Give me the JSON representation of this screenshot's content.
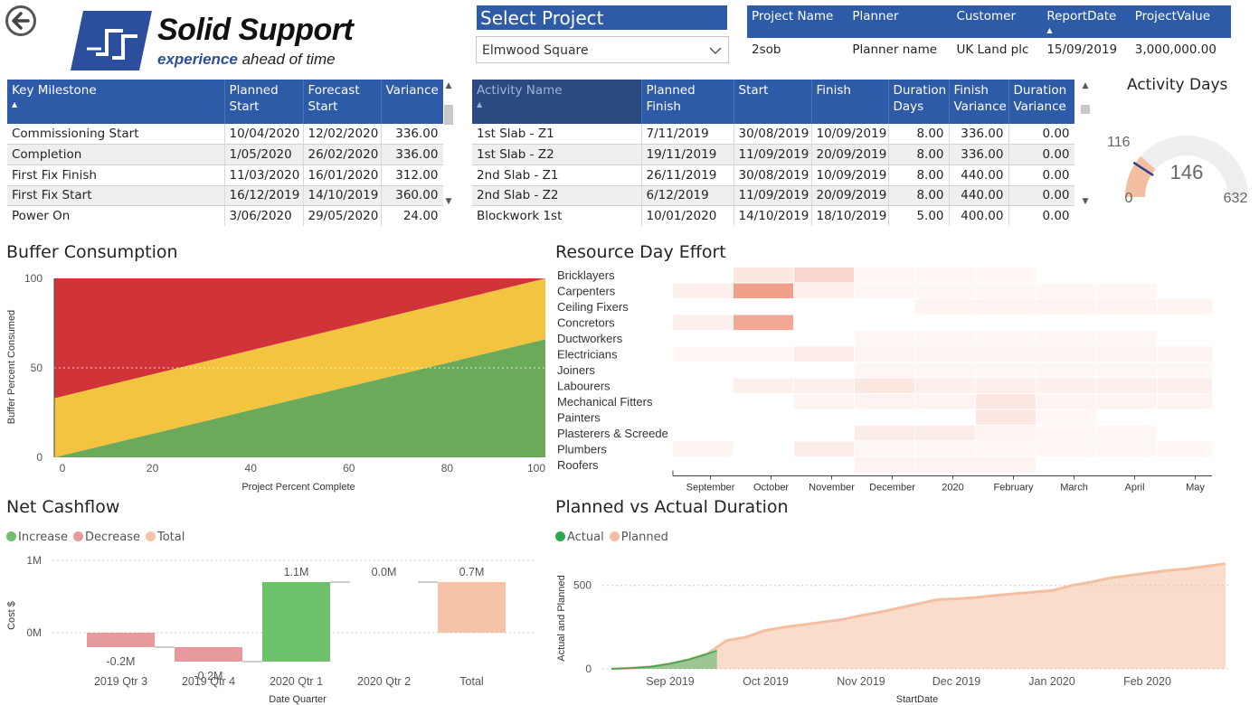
{
  "header": {
    "logo_title": "Solid Support",
    "logo_tag_bold": "experience",
    "logo_tag_rest": " ahead of time",
    "select_label": "Select Project",
    "select_value": "Elmwood Square"
  },
  "project_card": {
    "columns": [
      "Project Name",
      "Planner",
      "Customer",
      "ReportDate",
      "ProjectValue"
    ],
    "row": [
      "2sob",
      "Planner name",
      "UK Land plc",
      "15/09/2019",
      "3,000,000.00"
    ]
  },
  "milestones": {
    "columns": [
      "Key Milestone",
      "Planned Start",
      "Forecast Start",
      "Variance"
    ],
    "rows": [
      [
        "Commissioning Start",
        "10/04/2020",
        "12/02/2020",
        "336.00"
      ],
      [
        "Completion",
        "1/05/2020",
        "26/02/2020",
        "336.00"
      ],
      [
        "First Fix Finish",
        "11/03/2020",
        "16/01/2020",
        "312.00"
      ],
      [
        "First Fix Start",
        "16/12/2019",
        "14/10/2019",
        "360.00"
      ],
      [
        "Power On",
        "3/06/2020",
        "29/05/2020",
        "24.00"
      ]
    ]
  },
  "activities": {
    "columns": [
      "Activity Name",
      "Planned Finish",
      "Start",
      "Finish",
      "Duration Days",
      "Finish Variance",
      "Duration Variance"
    ],
    "rows": [
      [
        "1st Slab - Z1",
        "7/11/2019",
        "30/08/2019",
        "10/09/2019",
        "8.00",
        "336.00",
        "0.00"
      ],
      [
        "1st Slab - Z2",
        "19/11/2019",
        "11/09/2019",
        "20/09/2019",
        "8.00",
        "336.00",
        "0.00"
      ],
      [
        "2nd Slab - Z1",
        "26/11/2019",
        "30/08/2019",
        "10/09/2019",
        "8.00",
        "440.00",
        "0.00"
      ],
      [
        "2nd Slab - Z2",
        "6/12/2019",
        "11/09/2019",
        "20/09/2019",
        "8.00",
        "440.00",
        "0.00"
      ],
      [
        "Blockwork 1st",
        "10/01/2020",
        "14/10/2019",
        "18/10/2019",
        "5.00",
        "400.00",
        "0.00"
      ]
    ]
  },
  "gauge": {
    "title": "Activity Days",
    "value": 146,
    "value_label": "146",
    "min_label": "0",
    "max_label": "632",
    "target_label": "116",
    "min": 0,
    "max": 632,
    "target": 116,
    "fill_color": "#f4bfa0",
    "track_color": "#eeeeee",
    "target_color": "#2d3e8c"
  },
  "titles": {
    "buffer": "Buffer Consumption",
    "resource": "Resource Day Effort",
    "cashflow": "Net Cashflow",
    "planned_actual": "Planned vs Actual Duration"
  },
  "chart_data": [
    {
      "id": "buffer",
      "type": "area",
      "title": "Buffer Consumption",
      "xlabel": "Project Percent Complete",
      "ylabel": "Buffer Percent Consumed",
      "xlim": [
        0,
        100
      ],
      "ylim": [
        0,
        100
      ],
      "xticks": [
        0,
        20,
        40,
        60,
        80,
        100
      ],
      "yticks": [
        0,
        50,
        100
      ],
      "zones": [
        {
          "name": "green",
          "color": "#6aaa58",
          "upper_at_x0": 0,
          "upper_at_x100": 66
        },
        {
          "name": "yellow",
          "color": "#f2c43f",
          "upper_at_x0": 33,
          "upper_at_x100": 100
        },
        {
          "name": "red",
          "color": "#d13438",
          "upper_at_x0": 100,
          "upper_at_x100": 100
        }
      ]
    },
    {
      "id": "resource",
      "type": "heatmap",
      "title": "Resource Day Effort",
      "rows": [
        "Bricklayers",
        "Carpenters",
        "Ceiling Fixers",
        "Concretors",
        "Ductworkers",
        "Electricians",
        "Joiners",
        "Labourers",
        "Mechanical Fitters",
        "Painters",
        "Plasterers & Screede",
        "Plumbers",
        "Roofers"
      ],
      "x_labels": [
        "September",
        "October",
        "November",
        "December",
        "2020",
        "February",
        "March",
        "April",
        "May"
      ],
      "columns": 9,
      "intensity": [
        [
          0,
          0.15,
          0.25,
          0.05,
          0.05,
          0.05,
          0,
          0,
          0
        ],
        [
          0.1,
          0.6,
          0.1,
          0.05,
          0.05,
          0.05,
          0.05,
          0.05,
          0
        ],
        [
          0,
          0,
          0,
          0,
          0.08,
          0.08,
          0.08,
          0.08,
          0.08
        ],
        [
          0.1,
          0.55,
          0,
          0,
          0,
          0,
          0,
          0,
          0
        ],
        [
          0,
          0,
          0,
          0.05,
          0.05,
          0.05,
          0.05,
          0.05,
          0
        ],
        [
          0.05,
          0.05,
          0.12,
          0.08,
          0.08,
          0.08,
          0.08,
          0.08,
          0.08
        ],
        [
          0,
          0,
          0,
          0.05,
          0.05,
          0.05,
          0.05,
          0.05,
          0.05
        ],
        [
          0,
          0.1,
          0.1,
          0.15,
          0.1,
          0.1,
          0.1,
          0.1,
          0.1
        ],
        [
          0,
          0,
          0.08,
          0.08,
          0.08,
          0.15,
          0.08,
          0.08,
          0.08
        ],
        [
          0,
          0,
          0,
          0,
          0,
          0.15,
          0.05,
          0,
          0
        ],
        [
          0,
          0,
          0,
          0.12,
          0.12,
          0.08,
          0.05,
          0.05,
          0
        ],
        [
          0.08,
          0,
          0.12,
          0.05,
          0.05,
          0.05,
          0.05,
          0.05,
          0.05
        ],
        [
          0,
          0,
          0,
          0.08,
          0.08,
          0.08,
          0,
          0,
          0
        ]
      ],
      "color": "#e8603c"
    },
    {
      "id": "cashflow",
      "type": "bar",
      "subtype": "waterfall",
      "title": "Net Cashflow",
      "xlabel": "Date Quarter",
      "ylabel": "Cost $",
      "categories": [
        "2019 Qtr 3",
        "2019 Qtr 4",
        "2020 Qtr 1",
        "2020 Qtr 2",
        "Total"
      ],
      "values": [
        -0.2,
        -0.2,
        1.1,
        0.0,
        0.7
      ],
      "value_labels": [
        "-0.2M",
        "-0.2M",
        "1.1M",
        "0.0M",
        "0.7M"
      ],
      "yticks": [
        0,
        1
      ],
      "ytick_labels": [
        "0M",
        "1M"
      ],
      "legend": [
        {
          "name": "Increase",
          "color": "#6cc16a"
        },
        {
          "name": "Decrease",
          "color": "#e8999b"
        },
        {
          "name": "Total",
          "color": "#f4c3a8"
        }
      ]
    },
    {
      "id": "planned_actual",
      "type": "area",
      "title": "Planned vs Actual Duration",
      "xlabel": "StartDate",
      "ylabel": "Actual and Planned",
      "x_labels": [
        "Sep 2019",
        "Oct 2019",
        "Nov 2019",
        "Dec 2019",
        "Jan 2020",
        "Feb 2020"
      ],
      "yticks": [
        0,
        500
      ],
      "ylim": [
        0,
        650
      ],
      "legend": [
        {
          "name": "Actual",
          "color": "#2ca84e"
        },
        {
          "name": "Planned",
          "color": "#f4bfa0"
        }
      ],
      "series": [
        {
          "name": "Planned",
          "color": "#f4bfa0",
          "x_days": [
            0,
            10,
            20,
            30,
            40,
            50,
            60,
            70,
            80,
            90,
            100,
            110,
            120,
            130,
            140,
            150,
            160,
            170,
            180,
            190,
            200,
            210,
            220,
            230,
            240,
            250,
            260,
            270,
            280,
            290,
            300,
            310,
            320
          ],
          "values": [
            0,
            5,
            12,
            30,
            55,
            90,
            170,
            190,
            230,
            250,
            265,
            280,
            295,
            320,
            340,
            365,
            390,
            415,
            420,
            428,
            440,
            450,
            460,
            470,
            500,
            520,
            545,
            560,
            575,
            590,
            600,
            615,
            630
          ]
        },
        {
          "name": "Actual",
          "color": "#2ca84e",
          "x_days": [
            0,
            10,
            20,
            30,
            40,
            50,
            55
          ],
          "values": [
            0,
            5,
            12,
            30,
            55,
            90,
            110
          ]
        }
      ]
    }
  ]
}
